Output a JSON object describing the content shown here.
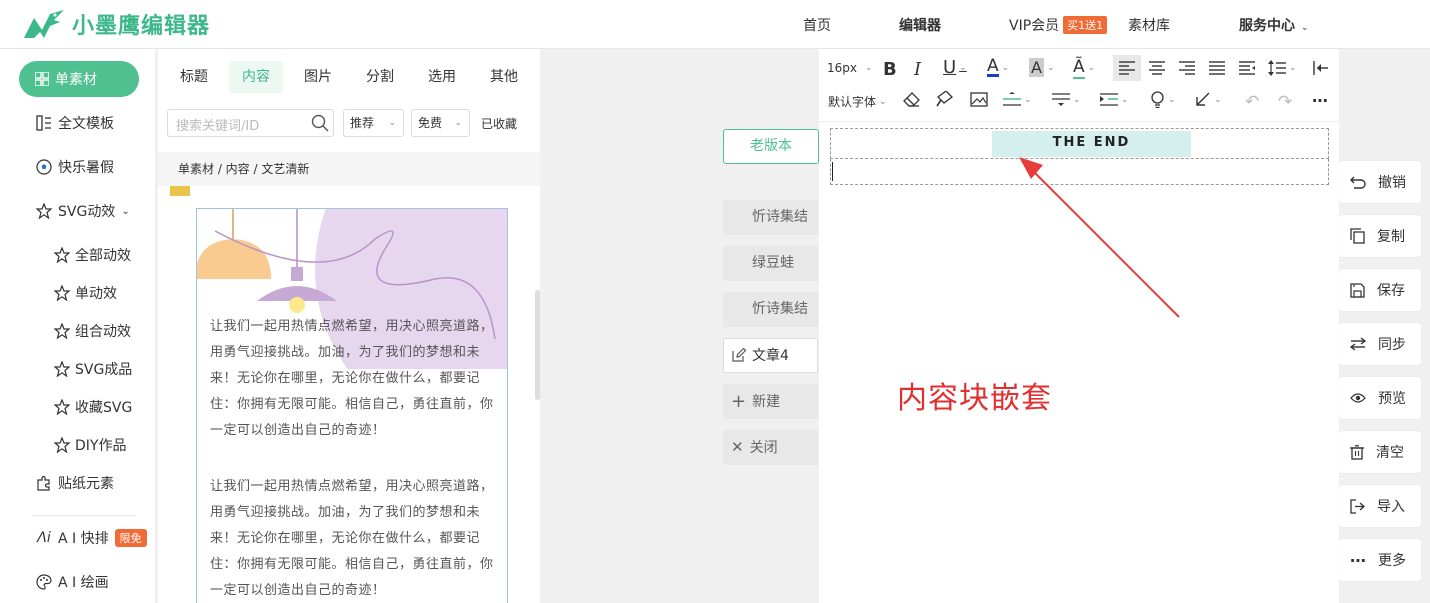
{
  "header": {
    "logo_text": "小墨鹰编辑器",
    "nav": {
      "home": "首页",
      "editor": "编辑器",
      "vip": "VIP会员",
      "vip_badge": "买1送1",
      "material": "素材库",
      "service": "服务中心"
    }
  },
  "sidebar": {
    "active": "单素材",
    "items": [
      "全文模板",
      "快乐暑假",
      "SVG动效"
    ],
    "sub_items": [
      "全部动效",
      "单动效",
      "组合动效",
      "SVG成品",
      "收藏SVG",
      "DIY作品"
    ],
    "bottom_items": [
      "贴纸元素",
      "A I 快排",
      "A I 绘画"
    ],
    "free_badge": "限免"
  },
  "panel": {
    "tabs": [
      "标题",
      "内容",
      "图片",
      "分割",
      "选用",
      "其他"
    ],
    "active_tab": "内容",
    "search_placeholder": "搜索关键词/ID",
    "dropdown_1": "推荐",
    "dropdown_2": "免费",
    "favorited": "已收藏",
    "breadcrumb": "单素材 / 内容 / 文艺清新",
    "card_paragraph_1": "让我们一起用热情点燃希望，用决心照亮道路，用勇气迎接挑战。加油，为了我们的梦想和未来！无论你在哪里，无论你在做什么，都要记住：你拥有无限可能。相信自己，勇往直前，你一定可以创造出自己的奇迹！",
    "card_paragraph_2": "让我们一起用热情点燃希望，用决心照亮道路，用勇气迎接挑战。加油，为了我们的梦想和未来！无论你在哪里，无论你在做什么，都要记住：你拥有无限可能。相信自己，勇往直前，你一定可以创造出自己的奇迹！"
  },
  "articles": {
    "old_version": "老版本",
    "list": [
      "忻诗集结",
      "绿豆蛙",
      "忻诗集结"
    ],
    "current": "文章4",
    "new": "新建",
    "close": "关闭"
  },
  "editor": {
    "font_size": "16px",
    "font_family": "默认字体",
    "end_text": "THE   END",
    "annotation": "内容块嵌套"
  },
  "right_actions": [
    "撤销",
    "复制",
    "保存",
    "同步",
    "预览",
    "清空",
    "导入",
    "更多"
  ],
  "colors": {
    "accent": "#4fc08f",
    "badge": "#f06b35",
    "annotation": "#e03030"
  }
}
